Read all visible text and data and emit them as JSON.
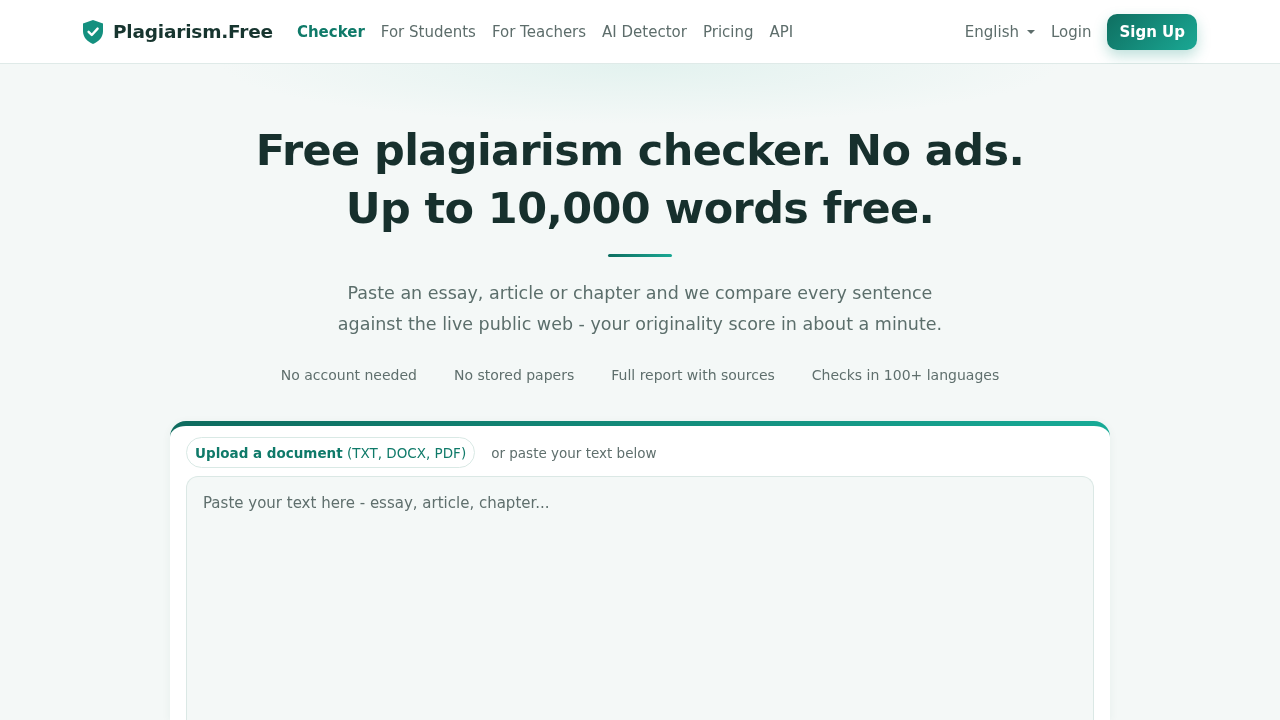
{
  "header": {
    "brand": "Plagiarism.Free",
    "nav": [
      {
        "label": "Checker",
        "selected": true
      },
      {
        "label": "For Students",
        "selected": false
      },
      {
        "label": "For Teachers",
        "selected": false
      },
      {
        "label": "AI Detector",
        "selected": false
      },
      {
        "label": "Pricing",
        "selected": false
      },
      {
        "label": "API",
        "selected": false
      }
    ],
    "language": "English",
    "login": "Login",
    "signup": "Sign Up"
  },
  "hero": {
    "title_lines": [
      "Free plagiarism checker. No ads.",
      "Up to 10,000 words free."
    ],
    "subtitle": "Paste an essay, article or chapter and we compare every sentence against the live public web - your originality score in about a minute.",
    "features": [
      "No account needed",
      "No stored papers",
      "Full report with sources",
      "Checks in 100+ languages"
    ]
  },
  "checker": {
    "upload_button": "**Upload a document** (TXT, DOCX, PDF)",
    "upload_hint": "or paste your text below",
    "text_field": {
      "placeholder": "Paste your text here - essay, article, chapter..."
    }
  }
}
